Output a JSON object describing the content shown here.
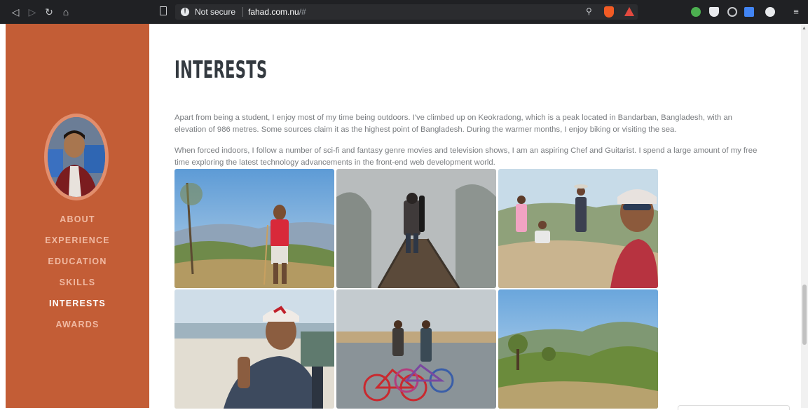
{
  "browser": {
    "security_label": "Not secure",
    "url_host": "fahad.com.nu",
    "url_hash": "/#",
    "icons": [
      "back-icon",
      "forward-icon",
      "reload-icon",
      "home-icon",
      "bookmark-icon",
      "info-icon",
      "zoom-icon",
      "brave-shield-icon",
      "bat-rewards-icon",
      "extension-icon",
      "profile-icon",
      "menu-icon"
    ]
  },
  "sidebar": {
    "nav_items": [
      {
        "label": "ABOUT"
      },
      {
        "label": "EXPERIENCE"
      },
      {
        "label": "EDUCATION"
      },
      {
        "label": "SKILLS"
      },
      {
        "label": "INTERESTS"
      },
      {
        "label": "AWARDS"
      }
    ],
    "active_item": "INTERESTS",
    "colors": {
      "background": "#c35d36",
      "link": "#f0b9a2",
      "active": "#ffffff"
    }
  },
  "main": {
    "heading": "INTERESTS",
    "paragraphs": [
      "Apart from being a student, I enjoy most of my time being outdoors. I've climbed up on Keokradong, which is a peak located in Bandarban, Bangladesh, with an elevation of 986 metres. Some sources claim it as the highest point of Bangladesh. During the warmer months, I enjoy biking or visiting the sea.",
      "When forced indoors, I follow a number of sci-fi and fantasy genre movies and television shows, I am an aspiring Chef and Guitarist. I spend a large amount of my free time exploring the latest technology advancements in the front-end web development world."
    ],
    "gallery": [
      {
        "subject": "hill-hiker-photo"
      },
      {
        "subject": "foggy-bridge-photo"
      },
      {
        "subject": "group-selfie-photo"
      },
      {
        "subject": "beach-selfie-photo"
      },
      {
        "subject": "bicycles-water-photo"
      },
      {
        "subject": "green-hills-photo"
      }
    ]
  }
}
